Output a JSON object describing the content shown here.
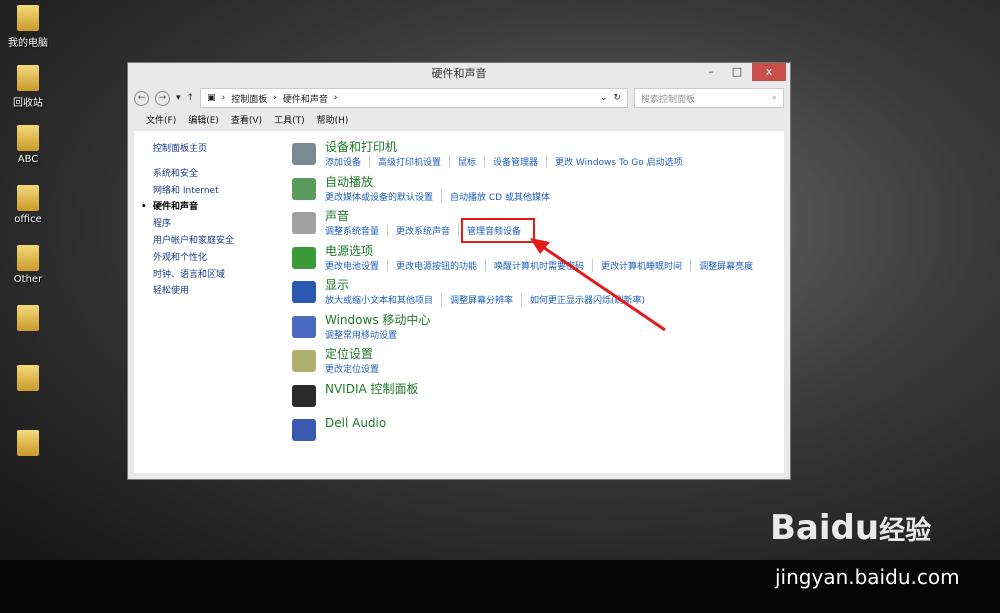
{
  "desktop": {
    "icons": [
      "我的电脑",
      "回收站",
      "ABC",
      "office",
      "Other",
      "",
      "",
      ""
    ]
  },
  "window": {
    "title": "硬件和声音",
    "close": "x",
    "address": {
      "path": [
        "控制面板",
        "硬件和声音"
      ],
      "search_placeholder": "搜索控制面板"
    },
    "menu": [
      "文件(F)",
      "编辑(E)",
      "查看(V)",
      "工具(T)",
      "帮助(H)"
    ],
    "sidebar": [
      "控制面板主页",
      "系统和安全",
      "网络和 Internet",
      "硬件和声音",
      "程序",
      "用户帐户和家庭安全",
      "外观和个性化",
      "时钟、语言和区域",
      "轻松使用"
    ],
    "categories": [
      {
        "title": "设备和打印机",
        "links": [
          "添加设备",
          "高级打印机设置",
          "鼠标",
          "设备管理器",
          "更改 Windows To Go 启动选项"
        ],
        "color": "#7a8a95"
      },
      {
        "title": "自动播放",
        "links": [
          "更改媒体或设备的默认设置",
          "自动播放 CD 或其他媒体"
        ],
        "color": "#5a9a5a"
      },
      {
        "title": "声音",
        "links": [
          "调整系统音量",
          "更改系统声音",
          "管理音频设备"
        ],
        "color": "#a0a0a0"
      },
      {
        "title": "电源选项",
        "links": [
          "更改电池设置",
          "更改电源按钮的功能",
          "唤醒计算机时需要密码",
          "更改计算机睡眠时间",
          "调整屏幕亮度"
        ],
        "color": "#3a9a3a"
      },
      {
        "title": "显示",
        "links": [
          "放大或缩小文本和其他项目",
          "调整屏幕分辨率",
          "如何更正显示器闪烁(刷新率)"
        ],
        "color": "#2a5ab0"
      },
      {
        "title": "Windows 移动中心",
        "links": [
          "调整常用移动设置"
        ],
        "color": "#4a6ac0"
      },
      {
        "title": "定位设置",
        "links": [
          "更改定位设置"
        ],
        "color": "#b0b070"
      },
      {
        "title": "NVIDIA 控制面板",
        "links": [],
        "color": "#2a2a2a"
      },
      {
        "title": "Dell Audio",
        "links": [],
        "color": "#3a5ab0"
      }
    ]
  },
  "watermark": {
    "brand": "Baidu经验",
    "url": "jingyan.baidu.com"
  },
  "annotation_color": "#e31b1b"
}
